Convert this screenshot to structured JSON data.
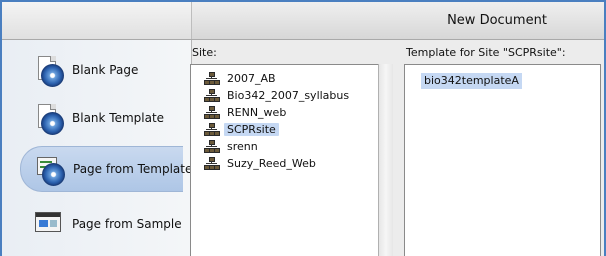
{
  "window": {
    "title": "New Document"
  },
  "sidebar": {
    "items": [
      {
        "label": "Blank Page",
        "icon": "blank-page-icon",
        "selected": false
      },
      {
        "label": "Blank Template",
        "icon": "blank-template-icon",
        "selected": false
      },
      {
        "label": "Page from Template",
        "icon": "page-from-template-icon",
        "selected": true
      },
      {
        "label": "Page from Sample",
        "icon": "page-from-sample-icon",
        "selected": false
      }
    ]
  },
  "site_panel": {
    "label": "Site:",
    "items": [
      {
        "name": "2007_AB",
        "selected": false
      },
      {
        "name": "Bio342_2007_syllabus",
        "selected": false
      },
      {
        "name": "RENN_web",
        "selected": false
      },
      {
        "name": "SCPRsite",
        "selected": true
      },
      {
        "name": "srenn",
        "selected": false
      },
      {
        "name": "Suzy_Reed_Web",
        "selected": false
      }
    ]
  },
  "template_panel": {
    "label": "Template for Site \"SCPRsite\":",
    "items": [
      {
        "name": "bio342templateA",
        "selected": true
      }
    ]
  },
  "colors": {
    "selection": "#c5d8f3",
    "sidebar_selected": "#aec6e6",
    "frame": "#4a7fc0"
  }
}
